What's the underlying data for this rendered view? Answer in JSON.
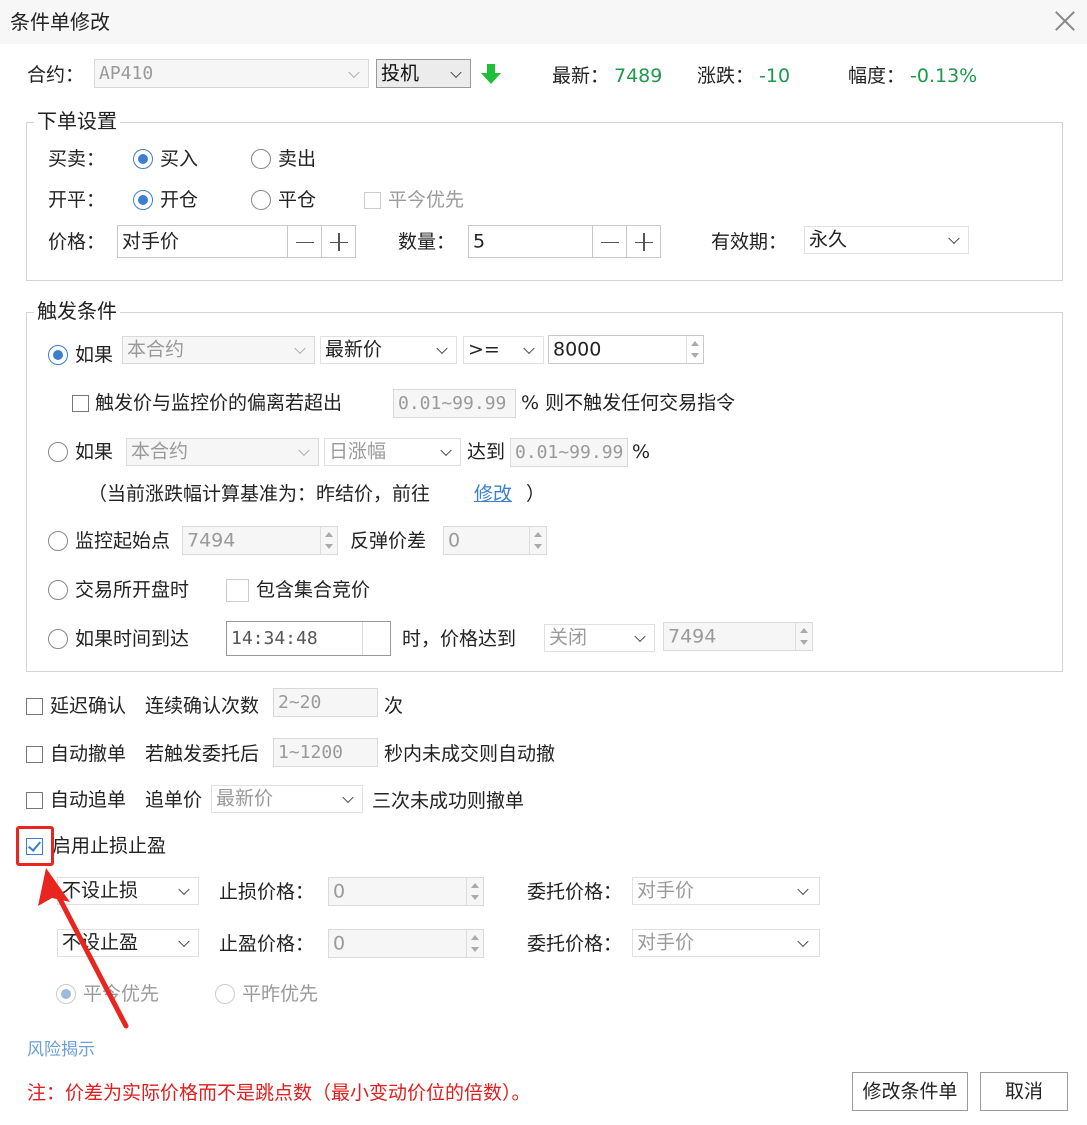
{
  "window": {
    "title": "条件单修改"
  },
  "contract": {
    "label": "合约：",
    "value": "AP410",
    "type_value": "投机",
    "latest_label": "最新：",
    "latest": "7489",
    "change_label": "涨跌：",
    "change": "-10",
    "amplitude_label": "幅度：",
    "amplitude": "-0.13%"
  },
  "order": {
    "title": "下单设置",
    "side_label": "买卖：",
    "buy": "买入",
    "sell": "卖出",
    "offset_label": "开平：",
    "open": "开仓",
    "close": "平仓",
    "close_today_first": "平今优先",
    "price_label": "价格：",
    "price": "对手价",
    "qty_label": "数量：",
    "qty": "5",
    "validity_label": "有效期：",
    "validity": "永久"
  },
  "trigger": {
    "title": "触发条件",
    "if1_label": "如果",
    "if1_contract": "本合约",
    "if1_price_type": "最新价",
    "if1_op": ">=",
    "if1_value": "8000",
    "deviation_text": "触发价与监控价的偏离若超出",
    "deviation_range": "0.01~99.99",
    "deviation_suffix": "% 则不触发任何交易指令",
    "if2_label": "如果",
    "if2_contract": "本合约",
    "if2_type": "日涨幅",
    "if2_reach": "达到",
    "if2_range": "0.01~99.99",
    "if2_pct": "%",
    "basis_prefix": "（当前涨跌幅计算基准为：昨结价，前往",
    "basis_link": "修改",
    "basis_suffix": "）",
    "monitor_label": "监控起始点",
    "monitor_value": "7494",
    "rebound_label": "反弹价差",
    "rebound_value": "0",
    "open_label": "交易所开盘时",
    "auction_label": "包含集合竞价",
    "time_label": "如果时间到达",
    "time_value": "14:34:48",
    "time_price_label": "时，价格达到",
    "time_state": "关闭",
    "time_price": "7494"
  },
  "options": {
    "delay_label": "延迟确认",
    "delay_desc": "连续确认次数",
    "delay_range": "2~20",
    "delay_unit": "次",
    "autocancel_label": "自动撤单",
    "autocancel_desc": "若触发委托后",
    "autocancel_range": "1~1200",
    "autocancel_suffix": "秒内未成交则自动撤",
    "chase_label": "自动追单",
    "chase_desc": "追单价",
    "chase_price": "最新价",
    "chase_suffix": "三次未成功则撤单",
    "sltp_label": "启用止损止盈",
    "sltp_checked": true
  },
  "stoploss": {
    "sl_mode": "不设止损",
    "sl_price_label": "止损价格：",
    "sl_price": "0",
    "sl_order_label": "委托价格：",
    "sl_order": "对手价",
    "tp_mode": "不设止盈",
    "tp_price_label": "止盈价格：",
    "tp_price": "0",
    "tp_order_label": "委托价格：",
    "tp_order": "对手价",
    "close_today_first": "平今优先",
    "close_yesterday_first": "平昨优先"
  },
  "footer": {
    "risk_link": "风险揭示",
    "note": "注：价差为实际价格而不是跳点数（最小变动价位的倍数）。",
    "modify_button": "修改条件单",
    "cancel_button": "取消"
  },
  "colors": {
    "accent": "#3b7fcf",
    "price_up_down": "#1c9a4a",
    "note": "#e21d1d",
    "annotation": "#e8251f"
  }
}
